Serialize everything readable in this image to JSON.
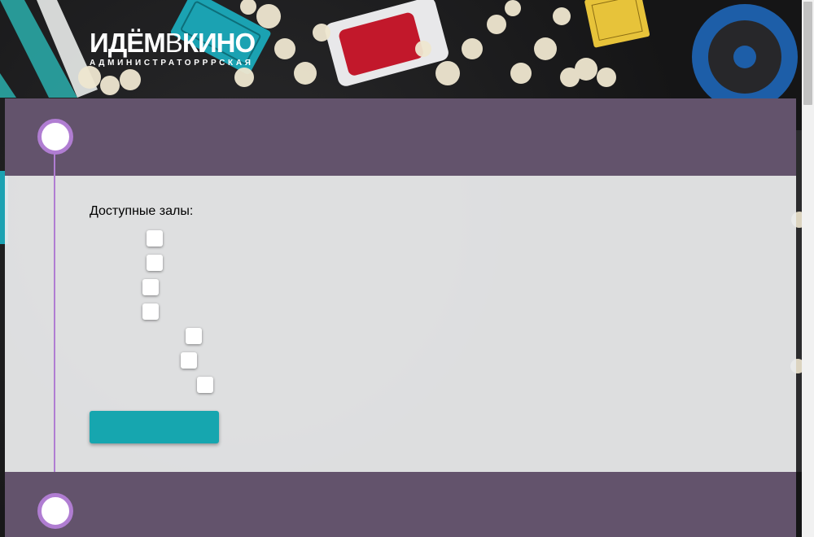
{
  "header": {
    "logo_part1": "ИДЁМ",
    "logo_part2": "В",
    "logo_part3": "КИНО",
    "subtitle": "АДМИНИСТРАТОРРРСКАЯ"
  },
  "config_section": {
    "title": "",
    "halls_label": "Доступные залы:",
    "halls": [
      {
        "name": "",
        "checked": false
      },
      {
        "name": "",
        "checked": false
      },
      {
        "name": "",
        "checked": false
      },
      {
        "name": "",
        "checked": false
      },
      {
        "name": "",
        "checked": false
      },
      {
        "name": "",
        "checked": false
      },
      {
        "name": "",
        "checked": false
      }
    ],
    "submit_label": ""
  },
  "next_section": {
    "title": ""
  },
  "colors": {
    "section_header": "#63536c",
    "timeline": "#b07dd2",
    "button": "#16a6af"
  }
}
